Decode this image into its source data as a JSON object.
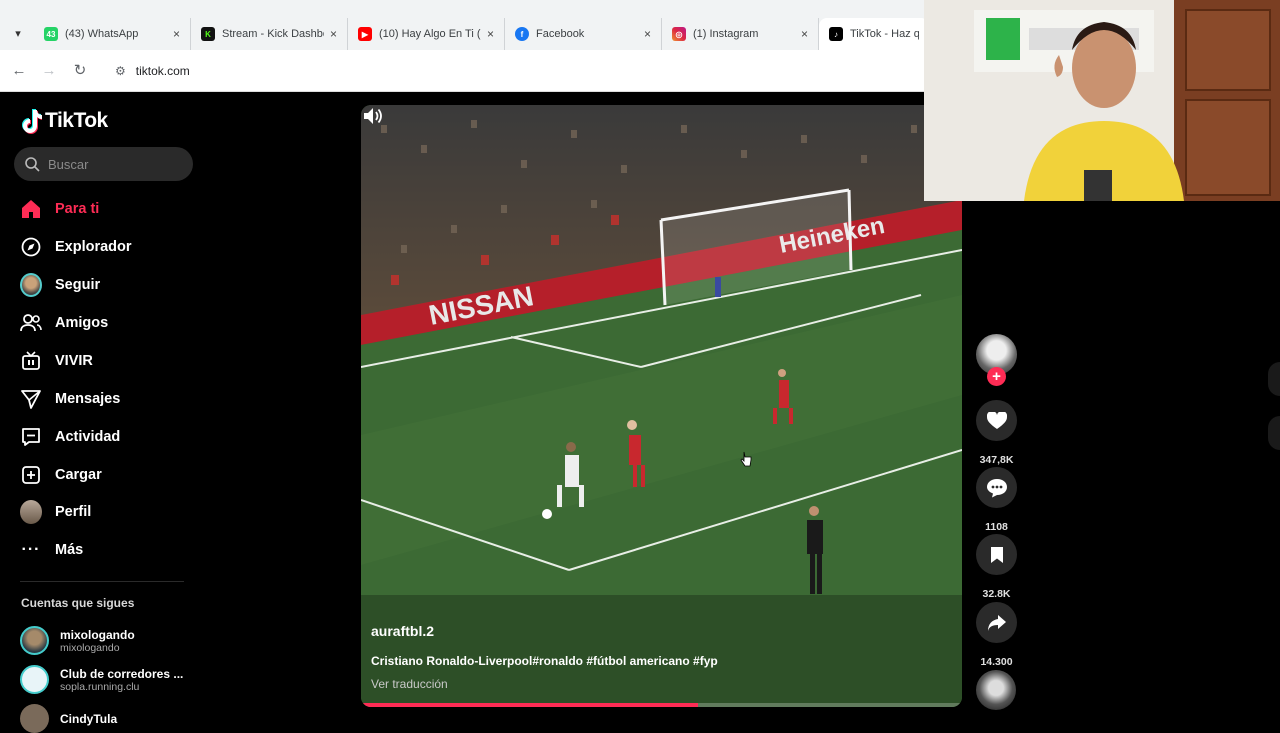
{
  "browser": {
    "tabs": [
      {
        "label": "(43) WhatsApp",
        "icon": "whatsapp-icon",
        "badge": "43",
        "color": "#25d366"
      },
      {
        "label": "Stream - Kick Dashbo",
        "icon": "kick-icon",
        "badge": "K",
        "color": "#53fc18"
      },
      {
        "label": "(10) Hay Algo En Ti (",
        "icon": "youtube-icon",
        "badge": "▶",
        "color": "#ff0000"
      },
      {
        "label": "Facebook",
        "icon": "facebook-icon",
        "badge": "f",
        "color": "#1877f2"
      },
      {
        "label": "(1) Instagram",
        "icon": "instagram-icon",
        "badge": "◎",
        "color": "#e1306c"
      },
      {
        "label": "TikTok - Haz que",
        "icon": "tiktok-icon",
        "badge": "♪",
        "color": "#000000"
      }
    ],
    "close_glyph": "×",
    "url": "tiktok.com"
  },
  "sidebar": {
    "brand": "TikTok",
    "search_placeholder": "Buscar",
    "nav": [
      {
        "label": "Para ti",
        "icon": "home-icon",
        "active": true
      },
      {
        "label": "Explorador",
        "icon": "compass-icon"
      },
      {
        "label": "Seguir",
        "icon": "avatar-icon"
      },
      {
        "label": "Amigos",
        "icon": "friends-icon"
      },
      {
        "label": "VIVIR",
        "icon": "live-icon"
      },
      {
        "label": "Mensajes",
        "icon": "messages-icon"
      },
      {
        "label": "Actividad",
        "icon": "activity-icon"
      },
      {
        "label": "Cargar",
        "icon": "upload-icon"
      },
      {
        "label": "Perfil",
        "icon": "profile-icon"
      },
      {
        "label": "Más",
        "icon": "more-icon"
      }
    ],
    "following_title": "Cuentas que sigues",
    "following": [
      {
        "name": "mixologando",
        "handle": "mixologando",
        "color": "#3a5a6a"
      },
      {
        "name": "Club de corredores ...",
        "handle": "sopla.running.clu",
        "color": "#e8f4f8"
      },
      {
        "name": "CindyTula",
        "handle": "",
        "color": "#7a6a5a"
      }
    ]
  },
  "video": {
    "author": "auraftbl.2",
    "description": "Cristiano Ronaldo-Liverpool#ronaldo #fútbol americano #fyp",
    "translate": "Ver traducción",
    "progress": 0.56,
    "ads": {
      "left": "NISSAN",
      "right": "Heineken"
    }
  },
  "actions": {
    "likes": "347,8K",
    "comments": "1108",
    "saves": "32.8K",
    "shares": "14.300"
  },
  "colors": {
    "accent": "#fe2c55",
    "pitch": "#3c6a34"
  }
}
